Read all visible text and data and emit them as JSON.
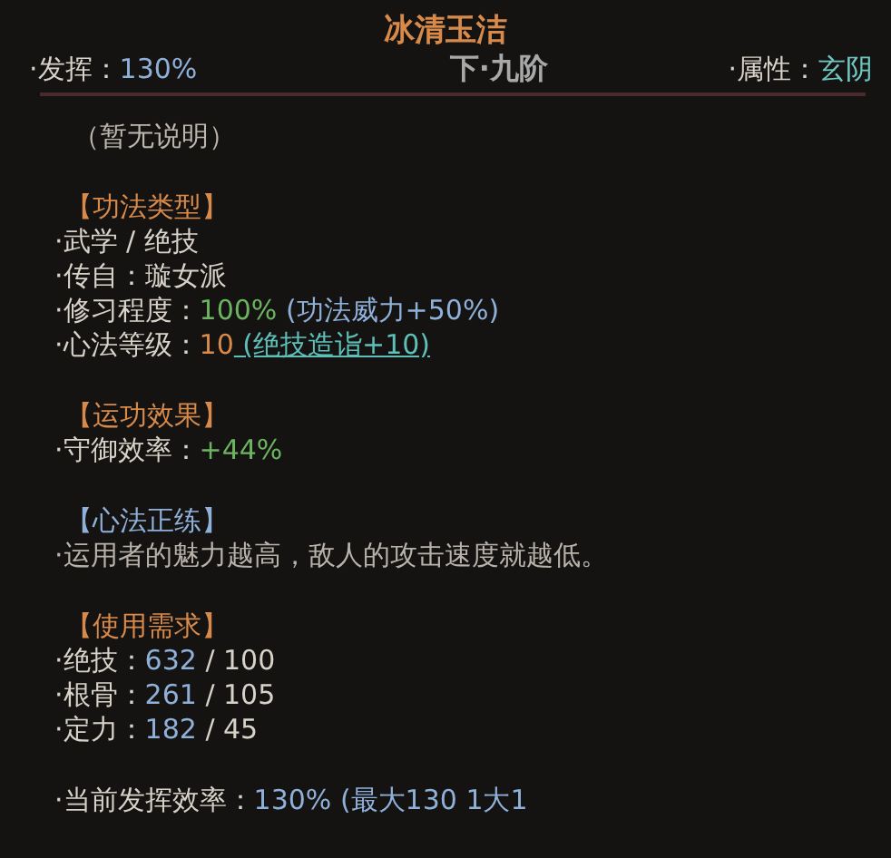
{
  "title": "冰清玉洁",
  "header": {
    "left": [
      {
        "text": "·发挥：",
        "kind": "plain"
      },
      {
        "text": "130%",
        "kind": "blue"
      }
    ],
    "grade": "下·九阶",
    "right": [
      {
        "text": "·属性：",
        "kind": "plain"
      },
      {
        "text": "玄阴",
        "kind": "teal"
      }
    ]
  },
  "description": "（暂无说明）",
  "sections": [
    {
      "heading": "【功法类型】",
      "kind": "orange",
      "lines": [
        [
          {
            "text": "·武学 / 绝技",
            "kind": "plain"
          }
        ],
        [
          {
            "text": "·传自：",
            "kind": "plain"
          },
          {
            "text": "璇女派",
            "kind": "plain"
          }
        ],
        [
          {
            "text": "·修习程度：",
            "kind": "plain"
          },
          {
            "text": "100%",
            "kind": "green"
          },
          {
            "text": " (功法威力+50%)",
            "kind": "blue"
          }
        ],
        [
          {
            "text": "·心法等级：",
            "kind": "plain"
          },
          {
            "text": "10",
            "kind": "orange"
          },
          {
            "text": " (绝技造诣+10)",
            "kind": "link"
          }
        ]
      ]
    },
    {
      "heading": "【运功效果】",
      "kind": "orange",
      "lines": [
        [
          {
            "text": "·守御效率：",
            "kind": "plain"
          },
          {
            "text": "+44%",
            "kind": "green"
          }
        ]
      ]
    },
    {
      "heading": "【心法正练】",
      "kind": "blue",
      "lines": [
        [
          {
            "text": "·运用者的魅力越高，敌人的攻击速度就越低。",
            "kind": "dim"
          }
        ]
      ]
    },
    {
      "heading": "【使用需求】",
      "kind": "orange",
      "lines": [
        [
          {
            "text": "·绝技：",
            "kind": "plain"
          },
          {
            "text": "632",
            "kind": "blue"
          },
          {
            "text": " / 100",
            "kind": "plain"
          }
        ],
        [
          {
            "text": "·根骨：",
            "kind": "plain"
          },
          {
            "text": "261",
            "kind": "blue"
          },
          {
            "text": " / 105",
            "kind": "plain"
          }
        ],
        [
          {
            "text": "·定力：",
            "kind": "plain"
          },
          {
            "text": "182",
            "kind": "blue"
          },
          {
            "text": " / 45",
            "kind": "plain"
          }
        ]
      ]
    },
    {
      "lines": [
        [
          {
            "text": "·当前发挥效率：",
            "kind": "plain"
          },
          {
            "text": "130%",
            "kind": "blue"
          },
          {
            "text": " (最大130 1大1",
            "kind": "blue"
          }
        ]
      ]
    }
  ]
}
